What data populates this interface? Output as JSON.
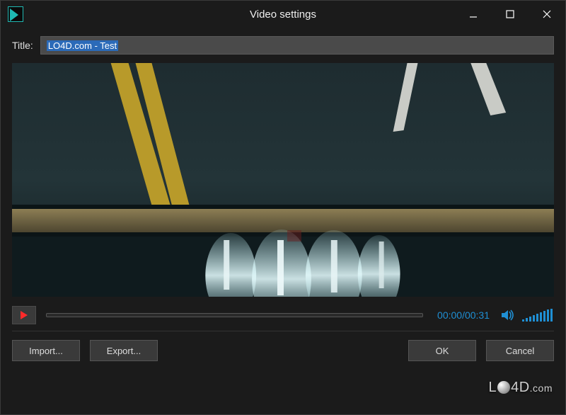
{
  "window": {
    "title": "Video settings"
  },
  "title_field": {
    "label": "Title:",
    "value": "LO4D.com - Test"
  },
  "player": {
    "timecode_current": "00:00",
    "timecode_total": "00:31",
    "timecode_display": "00:00/00:31"
  },
  "buttons": {
    "import": "Import...",
    "export": "Export...",
    "ok": "OK",
    "cancel": "Cancel"
  },
  "icons": {
    "minimize": "minimize-icon",
    "maximize": "maximize-icon",
    "close": "close-icon",
    "play": "play-icon",
    "volume": "volume-icon"
  },
  "colors": {
    "accent": "#1f8fd4",
    "play": "#ff2a2a",
    "brand": "#1fb8b2",
    "selection": "#2b6ab8"
  },
  "watermark": "LO4D.com"
}
